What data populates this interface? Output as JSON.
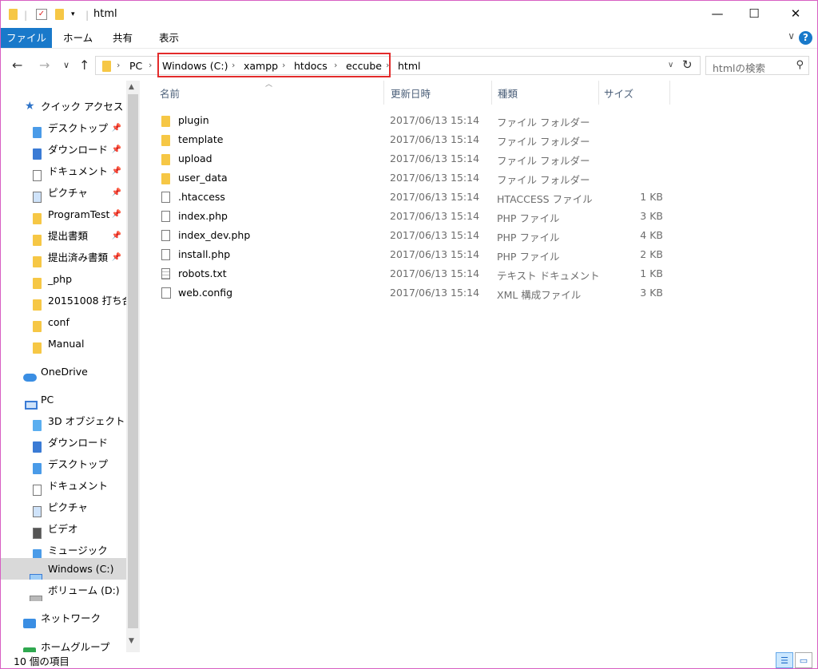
{
  "window": {
    "title": "html",
    "minimize": "—",
    "maximize": "☐",
    "close": "✕"
  },
  "ribbon": {
    "tabs": [
      {
        "label": "ファイル"
      },
      {
        "label": "ホーム"
      },
      {
        "label": "共有"
      },
      {
        "label": "表示"
      }
    ],
    "help": "?"
  },
  "nav": {
    "back": "←",
    "forward": "→",
    "recent": "∨",
    "up": "↑",
    "refresh": "↻",
    "dropdown": "∨"
  },
  "address": {
    "crumbs": [
      "PC",
      "Windows (C:)",
      "xampp",
      "htdocs",
      "eccube",
      "html"
    ]
  },
  "search": {
    "placeholder": "htmlの検索"
  },
  "navpane": {
    "quick_access": "クイック アクセス",
    "quick_items": [
      {
        "label": "デスクトップ",
        "pinned": true
      },
      {
        "label": "ダウンロード",
        "pinned": true
      },
      {
        "label": "ドキュメント",
        "pinned": true
      },
      {
        "label": "ピクチャ",
        "pinned": true
      },
      {
        "label": "ProgramTest",
        "pinned": true
      },
      {
        "label": "提出書類",
        "pinned": true
      },
      {
        "label": "提出済み書類",
        "pinned": true
      },
      {
        "label": "_php",
        "pinned": false
      },
      {
        "label": "20151008 打ち合",
        "pinned": false
      },
      {
        "label": "conf",
        "pinned": false
      },
      {
        "label": "Manual",
        "pinned": false
      }
    ],
    "onedrive": "OneDrive",
    "pc": "PC",
    "pc_items": [
      {
        "label": "3D オブジェクト"
      },
      {
        "label": "ダウンロード"
      },
      {
        "label": "デスクトップ"
      },
      {
        "label": "ドキュメント"
      },
      {
        "label": "ピクチャ"
      },
      {
        "label": "ビデオ"
      },
      {
        "label": "ミュージック"
      },
      {
        "label": "Windows (C:)"
      },
      {
        "label": "ボリューム (D:)"
      }
    ],
    "network": "ネットワーク",
    "homegroup": "ホームグループ"
  },
  "columns": {
    "name": "名前",
    "date": "更新日時",
    "type": "種類",
    "size": "サイズ"
  },
  "files": [
    {
      "name": "plugin",
      "date": "2017/06/13 15:14",
      "type": "ファイル フォルダー",
      "size": "",
      "icon": "folder-icon"
    },
    {
      "name": "template",
      "date": "2017/06/13 15:14",
      "type": "ファイル フォルダー",
      "size": "",
      "icon": "folder-icon"
    },
    {
      "name": "upload",
      "date": "2017/06/13 15:14",
      "type": "ファイル フォルダー",
      "size": "",
      "icon": "folder-icon"
    },
    {
      "name": "user_data",
      "date": "2017/06/13 15:14",
      "type": "ファイル フォルダー",
      "size": "",
      "icon": "folder-icon"
    },
    {
      "name": ".htaccess",
      "date": "2017/06/13 15:14",
      "type": "HTACCESS ファイル",
      "size": "1 KB",
      "icon": "file-icon"
    },
    {
      "name": "index.php",
      "date": "2017/06/13 15:14",
      "type": "PHP ファイル",
      "size": "3 KB",
      "icon": "file-icon"
    },
    {
      "name": "index_dev.php",
      "date": "2017/06/13 15:14",
      "type": "PHP ファイル",
      "size": "4 KB",
      "icon": "file-icon"
    },
    {
      "name": "install.php",
      "date": "2017/06/13 15:14",
      "type": "PHP ファイル",
      "size": "2 KB",
      "icon": "file-icon"
    },
    {
      "name": "robots.txt",
      "date": "2017/06/13 15:14",
      "type": "テキスト ドキュメント",
      "size": "1 KB",
      "icon": "text-file-icon"
    },
    {
      "name": "web.config",
      "date": "2017/06/13 15:14",
      "type": "XML 構成ファイル",
      "size": "3 KB",
      "icon": "config-file-icon"
    }
  ],
  "status": {
    "count": "10 個の項目"
  },
  "colors": {
    "accent": "#1979ca",
    "highlight": "#e32b2b",
    "window_border": "#d75ec3"
  }
}
